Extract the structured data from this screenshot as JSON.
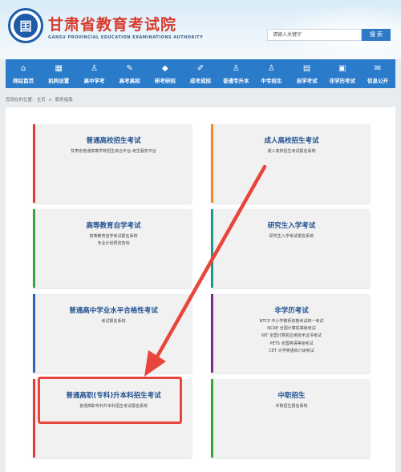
{
  "header": {
    "logo_glyph": "囯",
    "title": "甘肃省教育考试院",
    "subtitle": "GANSU PROVINCIAL EDUCATION EXAMINATIONS AUTHORITY",
    "search_placeholder": "请输入关键字",
    "search_button": "搜 索"
  },
  "nav": [
    {
      "icon": "home-icon",
      "glyph": "⌂",
      "label": "网站首页"
    },
    {
      "icon": "building-icon",
      "glyph": "▦",
      "label": "机构设置"
    },
    {
      "icon": "person-icon",
      "glyph": "♙",
      "label": "高中学考"
    },
    {
      "icon": "pencil-icon",
      "glyph": "✎",
      "label": "高考高招"
    },
    {
      "icon": "graduation-cap-icon",
      "glyph": "◆",
      "label": "研考研招"
    },
    {
      "icon": "edit-icon",
      "glyph": "✐",
      "label": "成考成招"
    },
    {
      "icon": "person-icon",
      "glyph": "♙",
      "label": "普通专升本"
    },
    {
      "icon": "person-icon",
      "glyph": "♙",
      "label": "中专招生"
    },
    {
      "icon": "book-icon",
      "glyph": "▤",
      "label": "自学考试"
    },
    {
      "icon": "certificate-icon",
      "glyph": "▣",
      "label": "非学历考试"
    },
    {
      "icon": "mail-icon",
      "glyph": "✉",
      "label": "信息公开"
    }
  ],
  "breadcrumb": {
    "prefix": "您现在的位置:",
    "home": "主页",
    "sep": ">",
    "current": "服务指南"
  },
  "cards": [
    {
      "title": "普通高校招生考试",
      "lines": [
        "甘肃省普通高等学校招生综合平台-考生服务平台"
      ],
      "color": "#e03c3c"
    },
    {
      "title": "成人高校招生考试",
      "lines": [
        "成人高校招生考试报名系统"
      ],
      "color": "#f28c1e"
    },
    {
      "title": "高等教育自学考试",
      "lines": [
        "高等教育自学考试报名系统",
        "专业计划预览查询"
      ],
      "color": "#3aa63a"
    },
    {
      "title": "研究生入学考试",
      "lines": [
        "研究生入学考试报名系统"
      ],
      "color": "#1e9a8c"
    },
    {
      "title": "普通高中学业水平合格性考试",
      "lines": [
        "考试报名系统"
      ],
      "color": "#2a63c4"
    },
    {
      "title": "非学历考试",
      "lines": [
        "NTCE 中小学教师资格考试统一考试",
        "NCRE 全国计算机等级考试",
        "NIT 全国计算机应用技术证书考试",
        "PETS 全国英语等级考试",
        "CET 大学英语四六级考试"
      ],
      "color": "#7b2c91"
    },
    {
      "title": "普通高职(专科)升本科招生考试",
      "lines": [
        "普通高职专科升本科招生考试报名系统"
      ],
      "color": "#e03c3c"
    },
    {
      "title": "中职招生",
      "lines": [
        "中职招生报名系统"
      ],
      "color": "#3aa63a"
    }
  ],
  "annotation_color": "#e8453c"
}
